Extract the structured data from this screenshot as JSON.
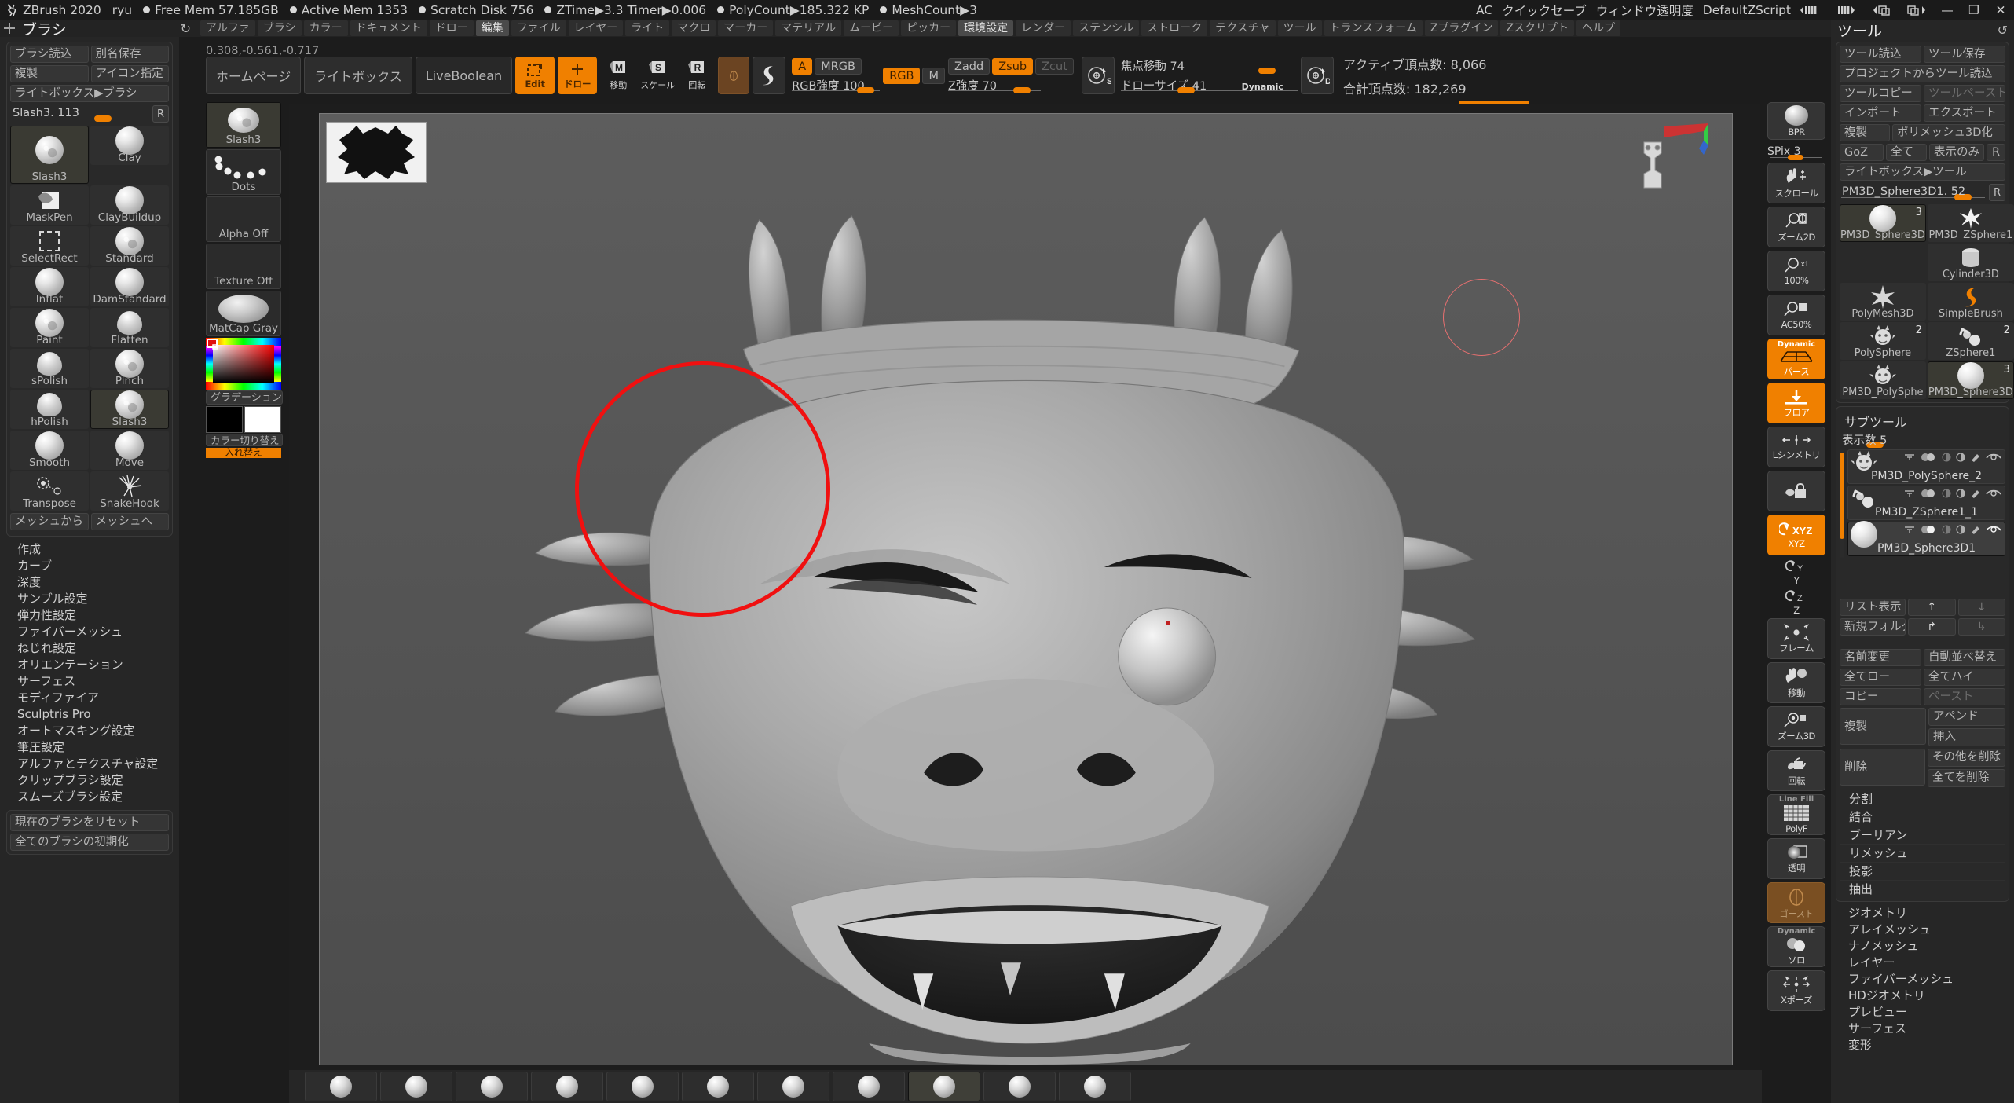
{
  "titlebar": {
    "app": "ZBrush 2020",
    "user": "ryu",
    "stats": [
      "Free Mem 57.185GB",
      "Active Mem 1353",
      "Scratch Disk 756",
      "ZTime▶3.3 Timer▶0.006",
      "PolyCount▶185.322 KP",
      "MeshCount▶3"
    ],
    "right": {
      "ac": "AC",
      "quicksave": "クイックセーブ",
      "transparency": "ウィンドウ透明度",
      "zscript": "DefaultZScript",
      "minimize": "—",
      "maximize": "❐",
      "close": "✕"
    }
  },
  "menubar": {
    "palette_title": "ブラシ",
    "items": [
      {
        "label": "アルファ",
        "active": false
      },
      {
        "label": "ブラシ",
        "active": false
      },
      {
        "label": "カラー",
        "active": false
      },
      {
        "label": "ドキュメント",
        "active": false
      },
      {
        "label": "ドロー",
        "active": false
      },
      {
        "label": "編集",
        "active": true
      },
      {
        "label": "ファイル",
        "active": false
      },
      {
        "label": "レイヤー",
        "active": false
      },
      {
        "label": "ライト",
        "active": false
      },
      {
        "label": "マクロ",
        "active": false
      },
      {
        "label": "マーカー",
        "active": false
      },
      {
        "label": "マテリアル",
        "active": false
      },
      {
        "label": "ムービー",
        "active": false
      },
      {
        "label": "ピッカー",
        "active": false
      },
      {
        "label": "環境設定",
        "active": true
      },
      {
        "label": "レンダー",
        "active": false
      },
      {
        "label": "ステンシル",
        "active": false
      },
      {
        "label": "ストローク",
        "active": false
      },
      {
        "label": "テクスチャ",
        "active": false
      },
      {
        "label": "ツール",
        "active": false
      },
      {
        "label": "トランスフォーム",
        "active": false
      },
      {
        "label": "Zプラグイン",
        "active": false
      },
      {
        "label": "Zスクリプト",
        "active": false
      },
      {
        "label": "ヘルプ",
        "active": false
      }
    ]
  },
  "brush_panel": {
    "title": "ブラシ",
    "buttons": {
      "load": "ブラシ読込",
      "save_as": "別名保存",
      "clone": "複製",
      "set_icon": "アイコン指定",
      "lightbox": "ライトボックス▶ブラシ",
      "mesh_from": "メッシュから",
      "mesh_to": "メッシュへ",
      "reset_current": "現在のブラシをリセット",
      "reset_all": "全てのブラシの初期化",
      "r": "R"
    },
    "slider": {
      "label": "Slash3. 113"
    },
    "grid": [
      {
        "label": "Slash3",
        "selected": true,
        "icon": "slash-sphere"
      },
      {
        "label": "Clay",
        "selected": false,
        "icon": "clay-sphere"
      },
      {
        "label": "MaskPen",
        "selected": false,
        "icon": "maskpen"
      },
      {
        "label": "ClayBuildup",
        "selected": false,
        "icon": "claybuildup-sphere"
      },
      {
        "label": "SelectRect",
        "selected": false,
        "icon": "dashed-rect"
      },
      {
        "label": "Standard",
        "selected": false,
        "icon": "standard-sphere"
      },
      {
        "label": "Inflat",
        "selected": false,
        "icon": "inflat-sphere"
      },
      {
        "label": "DamStandard",
        "selected": false,
        "icon": "damstandard-sphere"
      },
      {
        "label": "Paint",
        "selected": false,
        "icon": "paint-sphere"
      },
      {
        "label": "Flatten",
        "selected": false,
        "icon": "flatten-cone"
      },
      {
        "label": "sPolish",
        "selected": false,
        "icon": "spolish-cone"
      },
      {
        "label": "Pinch",
        "selected": false,
        "icon": "pinch-sphere"
      },
      {
        "label": "hPolish",
        "selected": false,
        "icon": "hpolish-cone"
      },
      {
        "label": "Slash3",
        "selected": true,
        "icon": "slash-sphere"
      },
      {
        "label": "Smooth",
        "selected": false,
        "icon": "smooth-sphere"
      },
      {
        "label": "Move",
        "selected": false,
        "icon": "move-sphere"
      },
      {
        "label": "Transpose",
        "selected": false,
        "icon": "transpose"
      },
      {
        "label": "SnakeHook",
        "selected": false,
        "icon": "snakehook"
      }
    ],
    "menu": [
      "作成",
      "カーブ",
      "深度",
      "サンプル設定",
      "弾力性設定",
      "ファイバーメッシュ",
      "ねじれ設定",
      "オリエンテーション",
      "サーフェス",
      "モディファイア",
      "Sculptris Pro",
      "オートマスキング設定",
      "筆圧設定",
      "アルファとテクスチャ設定",
      "クリップブラシ設定",
      "スムーズブラシ設定"
    ]
  },
  "col2": {
    "items": [
      {
        "label": "Slash3",
        "selected": true,
        "icon": "slash-sphere"
      },
      {
        "label": "Dots",
        "selected": false,
        "icon": "dots-stroke"
      },
      {
        "label": "Alpha Off",
        "selected": false,
        "icon": "empty"
      },
      {
        "label": "Texture Off",
        "selected": false,
        "icon": "empty"
      },
      {
        "label": "MatCap Gray",
        "selected": false,
        "icon": "matcap"
      }
    ],
    "gradient_label": "グラデーション",
    "switch_label": "入れ替え",
    "color_switch_label": "カラー切り替え"
  },
  "toolbar": {
    "coords": "0.308,-0.561,-0.717",
    "homepage": "ホームページ",
    "lightbox": "ライトボックス",
    "liveboolean": "LiveBoolean",
    "edit": "Edit",
    "draw": "ドロー",
    "move": "移動",
    "scale": "スケール",
    "rotate": "回転",
    "mrgb_a": "A",
    "mrgb": "MRGB",
    "rgb": "RGB",
    "m": "M",
    "zadd": "Zadd",
    "zsub": "Zsub",
    "zcut": "Zcut",
    "rgb_intensity": "RGB強度 100",
    "z_intensity": "Z強度 70",
    "focal_shift": "焦点移動 74",
    "draw_size": "ドローサイズ 41",
    "dynamic": "Dynamic",
    "active_points": "アクティブ頂点数: 8,066",
    "total_points": "合計頂点数: 182,269",
    "s_badge": "S",
    "d_badge": "D"
  },
  "shelf": {
    "bpr": "BPR",
    "spix": "SPix 3",
    "items": [
      {
        "label": "スクロール",
        "state": "off",
        "icon": "hand-scroll-icon"
      },
      {
        "label": "ズーム2D",
        "state": "off",
        "icon": "zoom2d-icon"
      },
      {
        "label": "100%",
        "state": "off",
        "icon": "actualsize-icon"
      },
      {
        "label": "AC50%",
        "state": "off",
        "icon": "aahalf-icon"
      },
      {
        "label": "パース",
        "state": "on",
        "icon": "perspective-icon",
        "top": "Dynamic"
      },
      {
        "label": "フロア",
        "state": "on",
        "icon": "floor-icon"
      },
      {
        "label": "Lシンメトリ",
        "state": "off",
        "icon": "symmetry-icon"
      },
      {
        "label": "",
        "state": "off",
        "icon": "lock-icon"
      },
      {
        "label": "XYZ",
        "state": "on",
        "icon": "xyz-icon"
      },
      {
        "label": "Y",
        "state": "plain",
        "icon": "y-axis-icon"
      },
      {
        "label": "Z",
        "state": "plain",
        "icon": "z-axis-icon"
      },
      {
        "label": "フレーム",
        "state": "off",
        "icon": "frame-icon"
      },
      {
        "label": "移動",
        "state": "off",
        "icon": "move3d-icon"
      },
      {
        "label": "ズーム3D",
        "state": "off",
        "icon": "zoom3d-icon"
      },
      {
        "label": "回転",
        "state": "off",
        "icon": "rotate3d-icon"
      },
      {
        "label": "PolyF",
        "state": "off",
        "icon": "polyframe-icon",
        "top": "Line Fill"
      },
      {
        "label": "透明",
        "state": "off",
        "icon": "transparency-icon"
      },
      {
        "label": "ゴースト",
        "state": "brown",
        "icon": "ghost-icon"
      },
      {
        "label": "ソロ",
        "state": "off",
        "icon": "solo-icon",
        "top": "Dynamic"
      },
      {
        "label": "Xポーズ",
        "state": "off",
        "icon": "xpose-icon"
      }
    ]
  },
  "tool_panel": {
    "title": "ツール",
    "buttons": {
      "load_tool": "ツール読込",
      "save_tool": "ツール保存",
      "load_from_project": "プロジェクトからツール読込",
      "copy_tool": "ツールコピー",
      "paste_tool": "ツールペースト",
      "import": "インポート",
      "export": "エクスポート",
      "clone": "複製",
      "make_polymesh3d": "ポリメッシュ3D化",
      "goz": "GoZ",
      "all": "全て",
      "visible_only": "表示のみ",
      "r": "R",
      "lightbox_tool": "ライトボックス▶ツール"
    },
    "slider": {
      "label": "PM3D_Sphere3D1. 52"
    },
    "grid": [
      {
        "label": "PM3D_Sphere3D",
        "selected": true,
        "num": "3",
        "icon": "sphere-icon"
      },
      {
        "label": "PM3D_ZSphere1",
        "selected": false,
        "num": "",
        "icon": "zsphere-armature-icon"
      },
      {
        "label": "",
        "selected": false,
        "num": "",
        "icon": "none"
      },
      {
        "label": "Cylinder3D",
        "selected": false,
        "num": "",
        "icon": "cylinder-icon"
      },
      {
        "label": "PolyMesh3D",
        "selected": false,
        "num": "",
        "icon": "star-icon"
      },
      {
        "label": "SimpleBrush",
        "selected": false,
        "num": "",
        "icon": "simplebrush-icon"
      },
      {
        "label": "PolySphere",
        "selected": false,
        "num": "2",
        "icon": "polysphere-creature-icon"
      },
      {
        "label": "ZSphere1",
        "selected": false,
        "num": "2",
        "icon": "zsphere-icon"
      },
      {
        "label": "PM3D_PolySphe",
        "selected": false,
        "num": "",
        "icon": "polysphere-creature-icon"
      },
      {
        "label": "PM3D_Sphere3D",
        "selected": true,
        "num": "3",
        "icon": "sphere-icon"
      }
    ],
    "subtool": {
      "title": "サブツール",
      "count_label": "表示数 5",
      "items": [
        {
          "name": "PM3D_PolySphere_2",
          "selected": false,
          "icon": "creature-icon"
        },
        {
          "name": "PM3D_ZSphere1_1",
          "selected": false,
          "icon": "zsphere-icon"
        },
        {
          "name": "PM3D_Sphere3D1",
          "selected": true,
          "icon": "sphere-icon"
        }
      ]
    },
    "subtool_buttons": {
      "list_view": "リスト表示",
      "new_folder": "新規フォルダ",
      "up": "↑",
      "down": "↓",
      "right": "↱",
      "down_right": "↳",
      "rename": "名前変更",
      "auto_reorder": "自動並べ替え",
      "all_low": "全てロー",
      "all_high": "全てハイ",
      "copy": "コピー",
      "paste": "ペースト",
      "duplicate": "複製",
      "append": "アペンド",
      "insert": "挿入",
      "delete": "削除",
      "delete_other": "その他を削除",
      "delete_all": "全てを削除"
    },
    "submenus": [
      "分割",
      "結合",
      "ブーリアン",
      "リメッシュ",
      "投影",
      "抽出"
    ],
    "bottom_menu": [
      "ジオメトリ",
      "アレイメッシュ",
      "ナノメッシュ",
      "レイヤー",
      "ファイバーメッシュ",
      "HDジオメトリ",
      "プレビュー",
      "サーフェス",
      "変形"
    ]
  },
  "bottom_strip": {
    "count": 11,
    "selected_index": 8
  },
  "colors": {
    "accent_orange": "#f08000",
    "panel_bg": "#262626",
    "canvas_bg": "#545454",
    "brush_circle_red": "#f01010"
  }
}
